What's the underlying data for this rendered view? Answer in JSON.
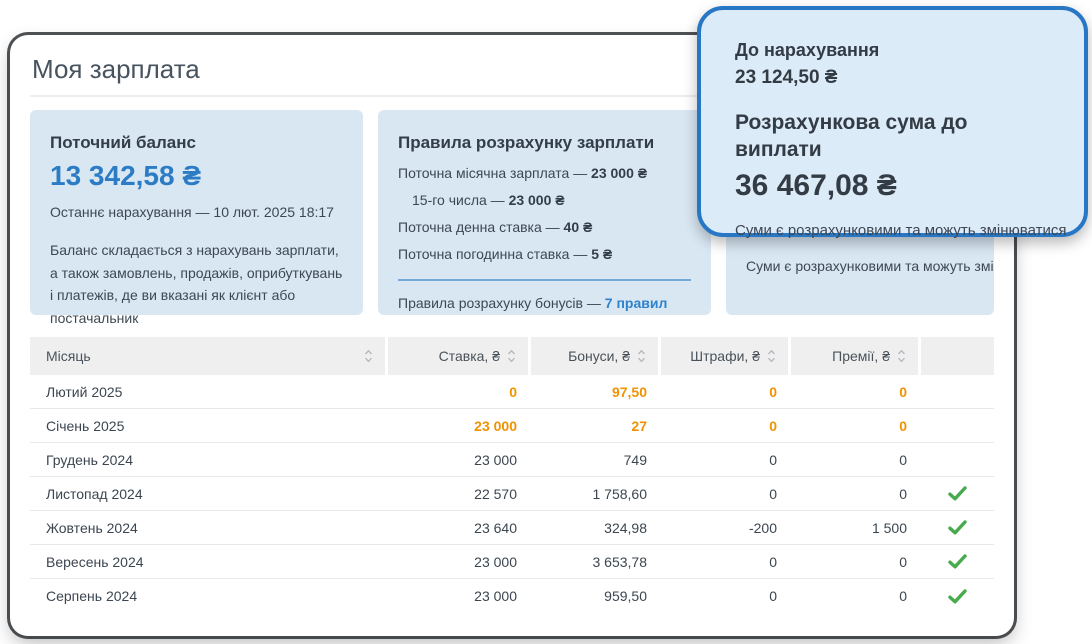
{
  "page": {
    "title": "Моя зарплата"
  },
  "colors": {
    "accent_blue": "#2b7cc5",
    "orange": "#f19200",
    "green_check": "#47ab4e",
    "card_background": "#d9e7f3",
    "popup_border": "#2777c5"
  },
  "icons": {
    "sort_icon": "up-down-chevrons",
    "paid_icon": "green-checkmark"
  },
  "cards": {
    "balance": {
      "title": "Поточний баланс",
      "amount": "13 342,58 ₴",
      "last_accrual": "Останнє нарахування — 10 лют. 2025 18:17",
      "description": "Баланс складається з нарахувань зарплати, а також замовлень, продажів, оприбуткувань і платежів, де ви вказані як клієнт або постачальник"
    },
    "rules": {
      "title": "Правила розрахунку зарплати",
      "lines": [
        {
          "label": "Поточна місячна зарплата — ",
          "value": "23 000 ₴"
        },
        {
          "label": "15-го числа — ",
          "value": "23 000 ₴"
        },
        {
          "label": "Поточна денна ставка — ",
          "value": "40 ₴"
        },
        {
          "label": "Поточна погодинна ставка — ",
          "value": "5 ₴"
        }
      ],
      "bonus_label": "Правила розрахунку бонусів — ",
      "bonus_link": "7 правил"
    }
  },
  "payout": {
    "accrual_label": "До нарахування",
    "accrual_amount": "23 124,50 ₴",
    "payout_label": "Розрахункова сума до виплати",
    "payout_amount": "36 467,08 ₴",
    "note": "Суми є розрахунковими та можуть змінюватися"
  },
  "table": {
    "columns": [
      {
        "key": "month",
        "label": "Місяць",
        "align": "left"
      },
      {
        "key": "rate",
        "label": "Ставка, ₴",
        "align": "right"
      },
      {
        "key": "bonuses",
        "label": "Бонуси, ₴",
        "align": "right"
      },
      {
        "key": "fines",
        "label": "Штрафи, ₴",
        "align": "right"
      },
      {
        "key": "premiums",
        "label": "Премії, ₴",
        "align": "right"
      },
      {
        "key": "paid",
        "label": "",
        "align": "right"
      }
    ],
    "rows": [
      {
        "month": "Лютий 2025",
        "rate": "0",
        "bonuses": "97,50",
        "fines": "0",
        "premiums": "0",
        "highlight": true,
        "paid": false
      },
      {
        "month": "Січень 2025",
        "rate": "23 000",
        "bonuses": "27",
        "fines": "0",
        "premiums": "0",
        "highlight": true,
        "paid": false
      },
      {
        "month": "Грудень 2024",
        "rate": "23 000",
        "bonuses": "749",
        "fines": "0",
        "premiums": "0",
        "highlight": false,
        "paid": false
      },
      {
        "month": "Листопад 2024",
        "rate": "22 570",
        "bonuses": "1 758,60",
        "fines": "0",
        "premiums": "0",
        "highlight": false,
        "paid": true
      },
      {
        "month": "Жовтень 2024",
        "rate": "23 640",
        "bonuses": "324,98",
        "fines": "-200",
        "premiums": "1 500",
        "highlight": false,
        "paid": true
      },
      {
        "month": "Вересень 2024",
        "rate": "23 000",
        "bonuses": "3 653,78",
        "fines": "0",
        "premiums": "0",
        "highlight": false,
        "paid": true
      },
      {
        "month": "Серпень 2024",
        "rate": "23 000",
        "bonuses": "959,50",
        "fines": "0",
        "premiums": "0",
        "highlight": false,
        "paid": true
      }
    ]
  }
}
